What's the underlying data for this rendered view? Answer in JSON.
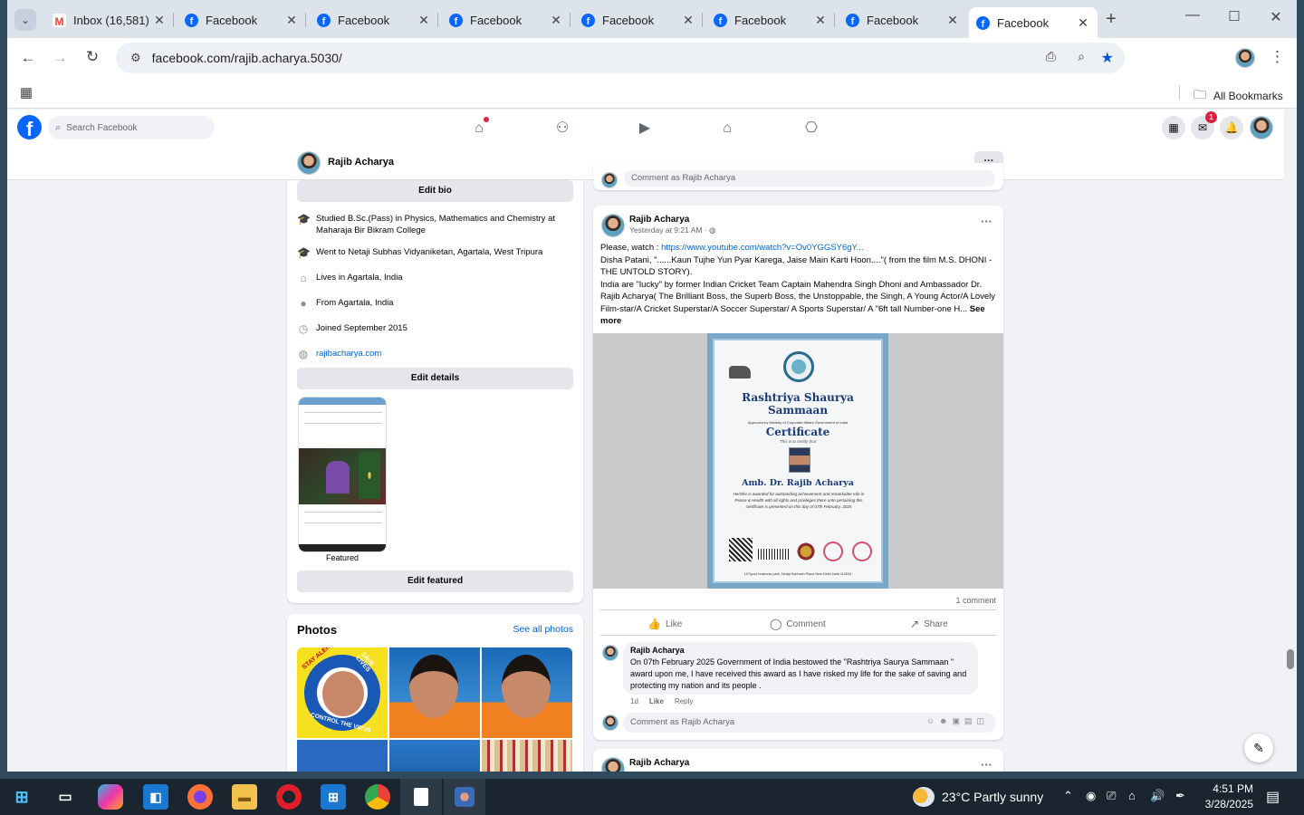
{
  "tabs": [
    {
      "label": "Inbox (16,581)",
      "icon": "gmail-icon"
    },
    {
      "label": "Facebook",
      "icon": "facebook-icon"
    },
    {
      "label": "Facebook",
      "icon": "facebook-icon"
    },
    {
      "label": "Facebook",
      "icon": "facebook-icon"
    },
    {
      "label": "Facebook",
      "icon": "facebook-icon"
    },
    {
      "label": "Facebook",
      "icon": "facebook-icon"
    },
    {
      "label": "Facebook",
      "icon": "facebook-icon"
    },
    {
      "label": "Facebook",
      "icon": "facebook-icon"
    }
  ],
  "browser": {
    "url": "facebook.com/rajib.acharya.5030/",
    "all_bookmarks": "All Bookmarks"
  },
  "fb": {
    "search_placeholder": "Search Facebook",
    "messenger_badge": "1",
    "profile_name": "Rajib Acharya",
    "more_label": "···"
  },
  "intro": {
    "edit_bio": "Edit bio",
    "details": [
      {
        "icon": "school-icon",
        "text": "Studied B.Sc.(Pass) in Physics, Mathematics and Chemistry at Maharaja Bir Bikram College"
      },
      {
        "icon": "school-icon",
        "text": "Went to Netaji Subhas Vidyaniketan, Agartala, West Tripura"
      },
      {
        "icon": "home-icon",
        "text": "Lives in Agartala, India"
      },
      {
        "icon": "location-icon",
        "text": "From Agartala, India"
      },
      {
        "icon": "clock-icon",
        "text": "Joined September 2015"
      },
      {
        "icon": "globe-icon",
        "text": "rajibacharya.com"
      }
    ],
    "edit_details": "Edit details",
    "featured_label": "Featured",
    "edit_featured": "Edit featured"
  },
  "photos": {
    "title": "Photos",
    "see_all": "See all photos",
    "sticker_top": "STAY ALERT",
    "sticker_right": "SAVE LIVES",
    "sticker_bottom": "CONTROL THE VIRUS"
  },
  "feed": {
    "prev_comment_placeholder": "Comment as Rajib Acharya",
    "post": {
      "author": "Rajib Acharya",
      "time": "Yesterday at 9:21 AM · ",
      "watch_prefix": "Please, watch : ",
      "link": "https://www.youtube.com/watch?v=Ov0YGGSY6gY...",
      "line1": " Disha Patani, \"......Kaun Tujhe Yun Pyar Karega, Jaise Main Karti Hoon....\"( from the film M.S. DHONI -THE UNTOLD STORY).",
      "line2": " India are \"lucky\" by former Indian Cricket Team Captain Mahendra Singh Dhoni and Ambassador Dr. Rajib Acharya( The Brilliant Boss, the Superb Boss, the Unstoppable, the Singh, A Young Actor/A Lovely Film-star/A Cricket Superstar/A Soccer Superstar/ A Sports Superstar/ A \"6ft tall Number-one H...",
      "see_more": " See more",
      "certificate": {
        "title_line1": "Rashtriya Shaurya",
        "title_line2": "Sammaan",
        "approved": "Approved by Ministry of Corporate Affairs Government of India",
        "heading": "Certificate",
        "certify": "This is to certify that",
        "recipient": "Amb. Dr. Rajib Acharya",
        "body": "He/She is awarded for outstanding achievement and remarkable role in Peace & Health with all rights and privileges there unto pertaining this certificate is presented on this day of 07th February, 2025",
        "address": "107/pool business park, Netaji Subhash Place,New Delhi India 110034"
      },
      "comment_count": "1 comment",
      "like": "Like",
      "comment": "Comment",
      "share": "Share",
      "reply": {
        "author": "Rajib Acharya",
        "text": "On 07th February 2025 Government of India bestowed the \"Rashtriya Saurya Sammaan \" award upon me, I have received this award as I have risked my life for the sake of saving and protecting my nation and its people .",
        "age": "1d",
        "like": "Like",
        "reply": "Reply"
      },
      "comment_placeholder": "Comment as Rajib Acharya"
    },
    "next_author": "Rajib Acharya"
  },
  "taskbar": {
    "weather": "23°C  Partly sunny",
    "time": "4:51 PM",
    "date": "3/28/2025"
  }
}
